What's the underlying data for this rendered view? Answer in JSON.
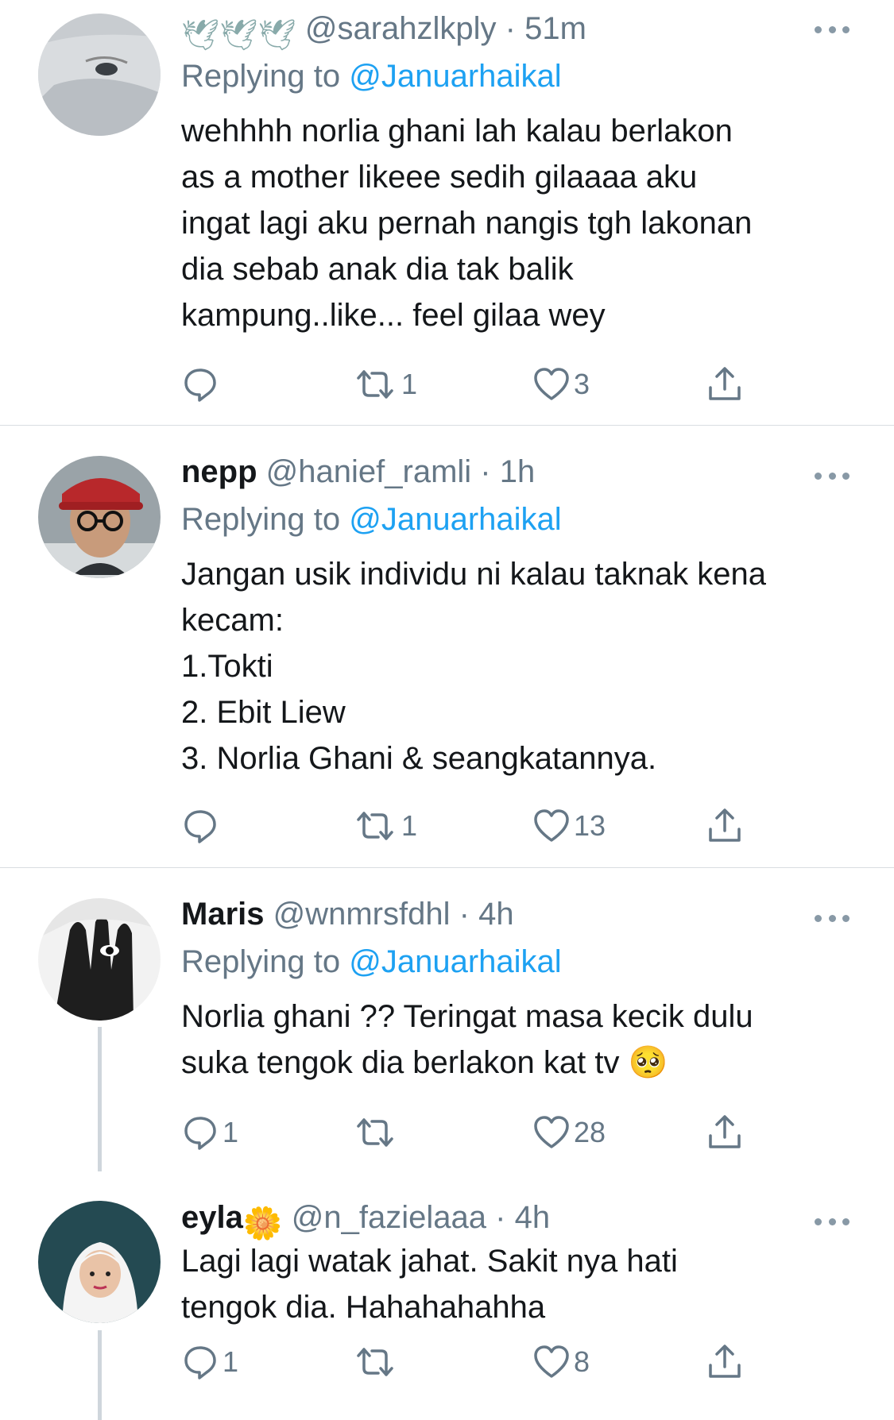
{
  "tweets": [
    {
      "display_name": "",
      "name_emoji": "🕊🕊🕊",
      "handle": "@sarahzlkply",
      "time": "51m",
      "replying_prefix": "Replying to",
      "replying_to": "@Januarhaikal",
      "text": "wehhhh norlia ghani lah kalau berlakon\nas a mother likeee sedih gilaaaa aku\ningat lagi aku pernah nangis tgh lakonan\ndia sebab anak dia tak balik\nkampung..like... feel gilaa wey",
      "replies": "",
      "retweets": "1",
      "likes": "3"
    },
    {
      "display_name": "nepp",
      "handle": "@hanief_ramli",
      "time": "1h",
      "replying_prefix": "Replying to",
      "replying_to": "@Januarhaikal",
      "text": "Jangan usik individu ni kalau taknak kena\nkecam:\n1.Tokti\n2. Ebit Liew\n3. Norlia Ghani & seangkatannya.",
      "replies": "",
      "retweets": "1",
      "likes": "13"
    },
    {
      "display_name": "Maris",
      "handle": "@wnmrsfdhl",
      "time": "4h",
      "replying_prefix": "Replying to",
      "replying_to": "@Januarhaikal",
      "text": "Norlia ghani ?? Teringat masa kecik dulu\nsuka tengok dia berlakon kat tv 🥺",
      "replies": "1",
      "retweets": "",
      "likes": "28"
    },
    {
      "display_name": "eyla",
      "name_emoji": "🌼",
      "handle": "@n_fazielaaa",
      "time": "4h",
      "text": "Lagi lagi watak jahat. Sakit nya hati\ntengok dia. Hahahahahha",
      "replies": "1",
      "retweets": "",
      "likes": "8"
    }
  ],
  "icons": {
    "reply": "reply-icon",
    "retweet": "retweet-icon",
    "like": "heart-icon",
    "share": "share-icon",
    "more": "more-icon"
  },
  "colors": {
    "text": "#14171a",
    "secondary": "#657786",
    "link": "#1da1f2",
    "divider": "#d9dde1"
  }
}
